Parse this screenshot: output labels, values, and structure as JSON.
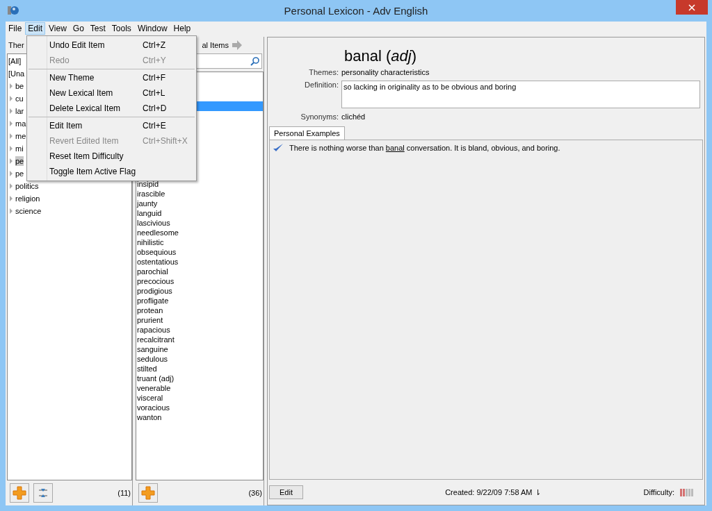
{
  "window": {
    "title": "Personal Lexicon - Adv English"
  },
  "menu_bar": [
    {
      "label": "File",
      "selected": false
    },
    {
      "label": "Edit",
      "selected": true
    },
    {
      "label": "View",
      "selected": false
    },
    {
      "label": "Go",
      "selected": false
    },
    {
      "label": "Test",
      "selected": false
    },
    {
      "label": "Tools",
      "selected": false
    },
    {
      "label": "Window",
      "selected": false
    },
    {
      "label": "Help",
      "selected": false
    }
  ],
  "edit_menu": [
    {
      "label": "Undo Edit Item",
      "shortcut": "Ctrl+Z",
      "disabled": false,
      "separator_after": false
    },
    {
      "label": "Redo",
      "shortcut": "Ctrl+Y",
      "disabled": true,
      "separator_after": true
    },
    {
      "label": "New Theme",
      "shortcut": "Ctrl+F",
      "disabled": false,
      "separator_after": false
    },
    {
      "label": "New Lexical Item",
      "shortcut": "Ctrl+L",
      "disabled": false,
      "separator_after": false
    },
    {
      "label": "Delete Lexical Item",
      "shortcut": "Ctrl+D",
      "disabled": false,
      "separator_after": true
    },
    {
      "label": "Edit Item",
      "shortcut": "Ctrl+E",
      "disabled": false,
      "separator_after": false
    },
    {
      "label": "Revert Edited Item",
      "shortcut": "Ctrl+Shift+X",
      "disabled": true,
      "separator_after": false
    },
    {
      "label": "Reset Item Difficulty",
      "disabled": false,
      "separator_after": false
    },
    {
      "label": "Toggle Item Active Flag",
      "disabled": false,
      "separator_after": false
    }
  ],
  "themes_pane": {
    "header": "Ther",
    "items": [
      {
        "label": "[All]",
        "kind": "special",
        "selected": false
      },
      {
        "label": "[Una",
        "kind": "special",
        "selected": false
      },
      {
        "label": "be",
        "kind": "theme",
        "selected": false
      },
      {
        "label": "cu",
        "kind": "theme",
        "selected": false
      },
      {
        "label": "lar",
        "kind": "theme",
        "selected": false
      },
      {
        "label": "ma",
        "kind": "theme",
        "selected": false
      },
      {
        "label": "me",
        "kind": "theme",
        "selected": false
      },
      {
        "label": "mi",
        "kind": "theme",
        "selected": false
      },
      {
        "label": "pe",
        "kind": "theme",
        "selected": true
      },
      {
        "label": "pe",
        "kind": "theme",
        "selected": false
      },
      {
        "label": "politics",
        "kind": "theme",
        "selected": false
      },
      {
        "label": "religion",
        "kind": "theme",
        "selected": false
      },
      {
        "label": "science",
        "kind": "theme",
        "selected": false
      }
    ],
    "count": "(11)"
  },
  "items_pane": {
    "header": "al Items",
    "selection_visible": true,
    "words": [
      "insipid",
      "irascible",
      "jaunty",
      "languid",
      "lascivious",
      "needlesome",
      "nihilistic",
      "obsequious",
      "ostentatious",
      "parochial",
      "precocious",
      "prodigious",
      "profligate",
      "protean",
      "prurient",
      "rapacious",
      "recalcitrant",
      "sanguine",
      "sedulous",
      "stilted",
      "truant (adj)",
      "venerable",
      "visceral",
      "voracious",
      "wanton"
    ],
    "count": "(36)"
  },
  "detail": {
    "heading": "banal (*adj*)",
    "fields": [
      {
        "label": "Themes:",
        "value": "personality characteristics",
        "kind": "text"
      },
      {
        "label": "Definition:",
        "value": "so lacking in originality as to be obvious and boring",
        "kind": "box"
      },
      {
        "label": "Synonyms:",
        "value": "clichéd",
        "kind": "text"
      }
    ],
    "tabs": [
      {
        "label": "Personal Examples",
        "selected": true
      }
    ],
    "examples": [
      {
        "before": "There is nothing worse than",
        "underlined": "banal",
        "after": "conversation. It is bland, obvious, and boring.",
        "checked": true
      }
    ],
    "edit_button": "Edit",
    "created": "Created: 9/22/09 7:58 AM ⇂",
    "difficulty_label": "Difficulty:",
    "difficulty": {
      "level": 0.4
    }
  }
}
